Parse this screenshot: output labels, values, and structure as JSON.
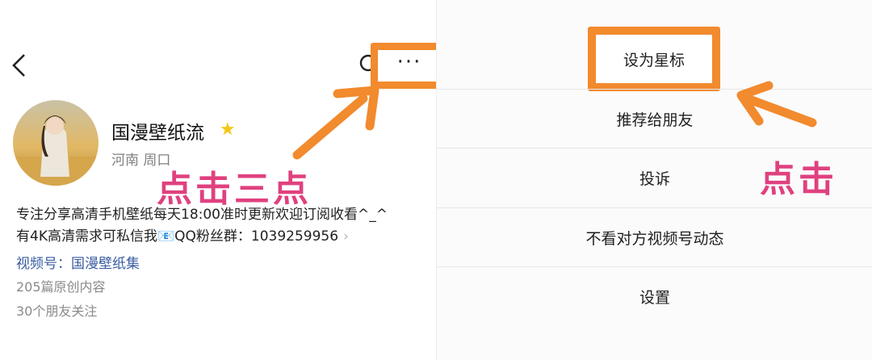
{
  "left": {
    "profile": {
      "name": "国漫壁纸流",
      "location": "河南 周口",
      "bio_line1": "专注分享高清手机壁纸每天18:00准时更新欢迎订阅收看^_^",
      "bio_line2": "有4K高清需求可私信我📧QQ粉丝群：1039259956",
      "channel_label": "视频号：国漫壁纸集",
      "original_count": "205篇原创内容",
      "friends_following": "30个朋友关注"
    },
    "more_label": "···",
    "annotation": "点击三点"
  },
  "right": {
    "menu": [
      "设为星标",
      "推荐给朋友",
      "投诉",
      "不看对方视频号动态",
      "设置"
    ],
    "annotation": "点击"
  },
  "colors": {
    "highlight": "#f28a2e",
    "annotation": "#e0417f",
    "link": "#3a5da0",
    "star": "#f5c518"
  },
  "icons": [
    "back-icon",
    "search-icon",
    "more-icon",
    "star-icon",
    "chevron-right-icon",
    "arrow-icon"
  ]
}
